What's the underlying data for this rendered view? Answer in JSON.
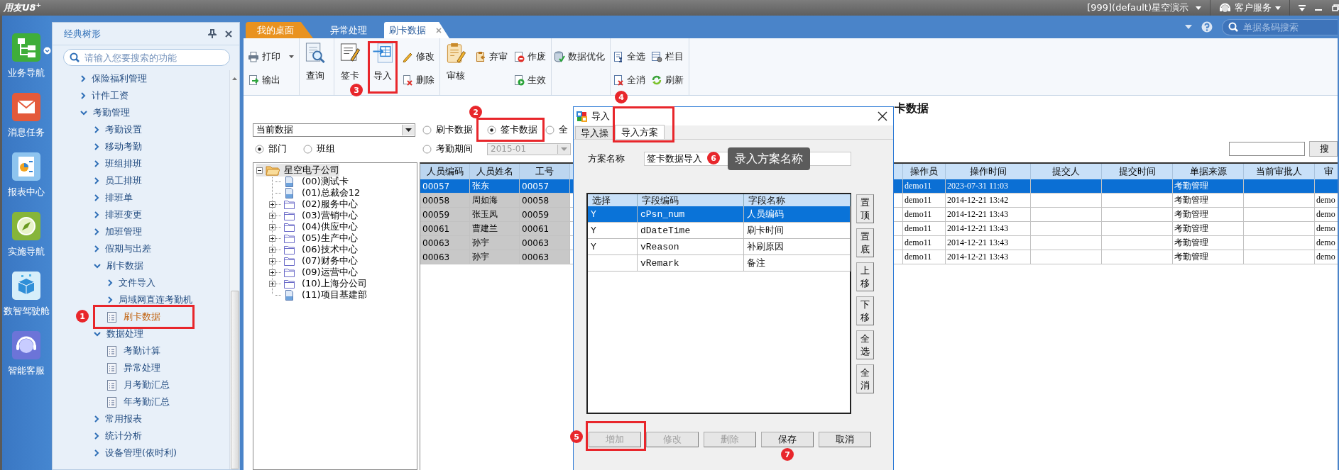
{
  "app": {
    "logo": "用友U8$^{+}$",
    "account": "[999](default)星空演示",
    "service": "客户服务"
  },
  "rail": [
    {
      "label": "业务导航",
      "kind": "tree",
      "dropdown": true
    },
    {
      "label": "消息任务",
      "kind": "mail",
      "dropdown": false
    },
    {
      "label": "报表中心",
      "kind": "report",
      "dropdown": false
    },
    {
      "label": "实施导航",
      "kind": "compass",
      "dropdown": false
    },
    {
      "label": "数智驾驶舱",
      "kind": "cube",
      "dropdown": false
    },
    {
      "label": "智能客服",
      "kind": "service",
      "dropdown": false
    }
  ],
  "sidebar": {
    "title": "经典树形",
    "search": {
      "placeholder": "请输入您要搜索的功能"
    },
    "tree": [
      {
        "label": "保险福利管理",
        "kind": "folder",
        "expanded": false,
        "selected": false
      },
      {
        "label": "计件工资",
        "kind": "folder",
        "expanded": false,
        "selected": false
      },
      {
        "label": "考勤管理",
        "kind": "folder",
        "expanded": true,
        "selected": false,
        "children": [
          {
            "label": "考勤设置",
            "kind": "folder",
            "expanded": false,
            "selected": false
          },
          {
            "label": "移动考勤",
            "kind": "folder",
            "expanded": false,
            "selected": false
          },
          {
            "label": "班组排班",
            "kind": "folder",
            "expanded": false,
            "selected": false
          },
          {
            "label": "员工排班",
            "kind": "folder",
            "expanded": false,
            "selected": false
          },
          {
            "label": "排班单",
            "kind": "folder",
            "expanded": false,
            "selected": false
          },
          {
            "label": "排班变更",
            "kind": "folder",
            "expanded": false,
            "selected": false
          },
          {
            "label": "加班管理",
            "kind": "folder",
            "expanded": false,
            "selected": false
          },
          {
            "label": "假期与出差",
            "kind": "folder",
            "expanded": false,
            "selected": false
          },
          {
            "label": "刷卡数据",
            "kind": "folder",
            "expanded": true,
            "selected": false,
            "children": [
              {
                "label": "文件导入",
                "kind": "folder",
                "expanded": false,
                "selected": false
              },
              {
                "label": "局域网直连考勤机",
                "kind": "folder",
                "expanded": false,
                "selected": false
              },
              {
                "label": "刷卡数据",
                "kind": "page",
                "selected": true,
                "callout": "1",
                "boxed": true
              }
            ]
          },
          {
            "label": "数据处理",
            "kind": "folder",
            "expanded": true,
            "selected": false,
            "children": [
              {
                "label": "考勤计算",
                "kind": "page",
                "selected": false
              },
              {
                "label": "异常处理",
                "kind": "page",
                "selected": false
              },
              {
                "label": "月考勤汇总",
                "kind": "page",
                "selected": false
              },
              {
                "label": "年考勤汇总",
                "kind": "page",
                "selected": false
              }
            ]
          },
          {
            "label": "常用报表",
            "kind": "folder",
            "expanded": false,
            "selected": false
          },
          {
            "label": "统计分析",
            "kind": "folder",
            "expanded": false,
            "selected": false
          },
          {
            "label": "设备管理(依时利)",
            "kind": "folder",
            "expanded": false,
            "selected": false
          }
        ]
      }
    ]
  },
  "tabs": [
    {
      "label": "我的桌面",
      "kind": "home",
      "selected": false,
      "closable": false
    },
    {
      "label": "异常处理",
      "kind": "page",
      "selected": false,
      "closable": false
    },
    {
      "label": "刷卡数据",
      "kind": "page",
      "selected": true,
      "closable": true
    }
  ],
  "header_search": {
    "placeholder": "单据条码搜索"
  },
  "toolbar": [
    {
      "columns": [
        [
          {
            "label": "打印",
            "kind": "print",
            "dropdown": true
          },
          {
            "label": "输出",
            "kind": "export"
          }
        ]
      ]
    },
    {
      "columns": [
        [
          {
            "label": "查询",
            "kind": "query",
            "large": true
          }
        ]
      ]
    },
    {
      "columns": [
        [
          {
            "label": "签卡",
            "kind": "sign",
            "large": true
          }
        ],
        [
          {
            "label": "导入",
            "kind": "import",
            "large": true,
            "callout": "3",
            "boxed": true
          }
        ],
        [
          {
            "label": "修改",
            "kind": "edit"
          },
          {
            "label": "删除",
            "kind": "delete"
          }
        ]
      ]
    },
    {
      "columns": [
        [
          {
            "label": "审核",
            "kind": "audit",
            "large": true
          }
        ],
        [
          {
            "label": "弃审",
            "kind": "unaudit"
          }
        ],
        [
          {
            "label": "作废",
            "kind": "void"
          },
          {
            "label": "生效",
            "kind": "effect"
          }
        ]
      ]
    },
    {
      "columns": [
        [
          {
            "label": "数据优化",
            "kind": "optimize"
          }
        ]
      ]
    },
    {
      "columns": [
        [
          {
            "label": "全选",
            "kind": "selectall"
          },
          {
            "label": "全消",
            "kind": "unselect"
          }
        ],
        [
          {
            "label": "栏目",
            "kind": "columns"
          },
          {
            "label": "刷新",
            "kind": "refresh"
          }
        ]
      ]
    }
  ],
  "page": {
    "title": "卡数据",
    "data_select": {
      "value": "当前数据"
    },
    "scope_options": [
      {
        "label": "部门",
        "selected": true
      },
      {
        "label": "班组",
        "selected": false
      }
    ],
    "type_options": [
      {
        "label": "刷卡数据",
        "selected": false
      },
      {
        "label": "签卡数据",
        "selected": true,
        "callout": "2",
        "boxed": true
      },
      {
        "label": "全",
        "selected": false
      }
    ],
    "period": {
      "label": "考勤期间",
      "selected": false,
      "value": "2015-01",
      "disabled": true
    },
    "search_button": "搜",
    "org_tree": [
      {
        "label": "星空电子公司",
        "kind": "root",
        "expanded": true,
        "selected": true,
        "children": [
          {
            "label": "(00)测试卡",
            "kind": "leaf",
            "selected": false
          },
          {
            "label": "(01)总裁会12",
            "kind": "leaf",
            "selected": false
          },
          {
            "label": "(02)服务中心",
            "kind": "folder",
            "expanded": false,
            "selected": false
          },
          {
            "label": "(03)营销中心",
            "kind": "folder",
            "expanded": false,
            "selected": false
          },
          {
            "label": "(04)供应中心",
            "kind": "folder",
            "expanded": false,
            "selected": false
          },
          {
            "label": "(05)生产中心",
            "kind": "folder",
            "expanded": false,
            "selected": false
          },
          {
            "label": "(06)技术中心",
            "kind": "folder",
            "expanded": false,
            "selected": false
          },
          {
            "label": "(07)财务中心",
            "kind": "folder",
            "expanded": false,
            "selected": false
          },
          {
            "label": "(09)运营中心",
            "kind": "folder",
            "expanded": false,
            "selected": false
          },
          {
            "label": "(10)上海分公司",
            "kind": "folder",
            "expanded": false,
            "selected": false
          },
          {
            "label": "(11)项目基建部",
            "kind": "leaf",
            "selected": false
          }
        ]
      }
    ],
    "grid": {
      "columns": [
        {
          "label": "人员编码",
          "frozen": true
        },
        {
          "label": "人员姓名",
          "frozen": true
        },
        {
          "label": "工号",
          "frozen": true
        },
        {
          "label": "操作员",
          "frozen": false
        },
        {
          "label": "操作时间",
          "frozen": false
        },
        {
          "label": "提交人",
          "frozen": false
        },
        {
          "label": "提交时间",
          "frozen": false
        },
        {
          "label": "单据来源",
          "frozen": false
        },
        {
          "label": "当前审批人",
          "frozen": false
        },
        {
          "label": "审",
          "frozen": false
        }
      ],
      "rows": [
        {
          "selected": true,
          "cells": [
            "00057",
            "张东",
            "00057",
            "demo11",
            "2023-07-31 11:03",
            null,
            null,
            "考勤管理",
            null,
            null
          ]
        },
        {
          "selected": false,
          "cells": [
            "00058",
            "周如海",
            "00058",
            "demo11",
            "2014-12-21 13:42",
            null,
            null,
            "考勤管理",
            null,
            "demo"
          ]
        },
        {
          "selected": false,
          "cells": [
            "00059",
            "张玉凤",
            "00059",
            "demo11",
            "2014-12-21 13:43",
            null,
            null,
            "考勤管理",
            null,
            "demo"
          ]
        },
        {
          "selected": false,
          "cells": [
            "00061",
            "曹建兰",
            "00061",
            "demo11",
            "2014-12-21 13:43",
            null,
            null,
            "考勤管理",
            null,
            "demo"
          ]
        },
        {
          "selected": false,
          "cells": [
            "00063",
            "孙宇",
            "00063",
            "demo11",
            "2014-12-21 13:43",
            null,
            null,
            "考勤管理",
            null,
            "demo"
          ]
        },
        {
          "selected": false,
          "cells": [
            "00063",
            "孙宇",
            "00063",
            "demo11",
            "2014-12-21 13:43",
            null,
            null,
            "考勤管理",
            null,
            "demo"
          ]
        }
      ]
    }
  },
  "dialog": {
    "title": "导入",
    "tabs": [
      {
        "label": "导入操",
        "selected": false
      },
      {
        "label": "导入方案",
        "selected": true,
        "callout": "4",
        "boxed": true
      }
    ],
    "scheme_label": "方案名称",
    "scheme_value": "签卡数据导入",
    "hint": {
      "callout": "6",
      "text": "录入方案名称"
    },
    "columns": [
      "选择",
      "字段编码",
      "字段名称"
    ],
    "rows": [
      {
        "selected": true,
        "cells": [
          "Y",
          "cPsn_num",
          "人员编码"
        ]
      },
      {
        "selected": false,
        "cells": [
          "Y",
          "dDateTime",
          "刷卡时间"
        ]
      },
      {
        "selected": false,
        "cells": [
          "Y",
          "vReason",
          "补刷原因"
        ]
      },
      {
        "selected": false,
        "cells": [
          null,
          "vRemark",
          "备注"
        ]
      }
    ],
    "side_buttons": [
      "置顶",
      "置底",
      "上移",
      "下移",
      "全选",
      "全消"
    ],
    "buttons": [
      {
        "label": "增加",
        "disabled": true,
        "callout": "5",
        "boxed": true
      },
      {
        "label": "修改",
        "disabled": true
      },
      {
        "label": "删除",
        "disabled": true
      },
      {
        "label": "保存",
        "disabled": false,
        "callout": "7"
      },
      {
        "label": "取消",
        "disabled": false
      }
    ]
  }
}
